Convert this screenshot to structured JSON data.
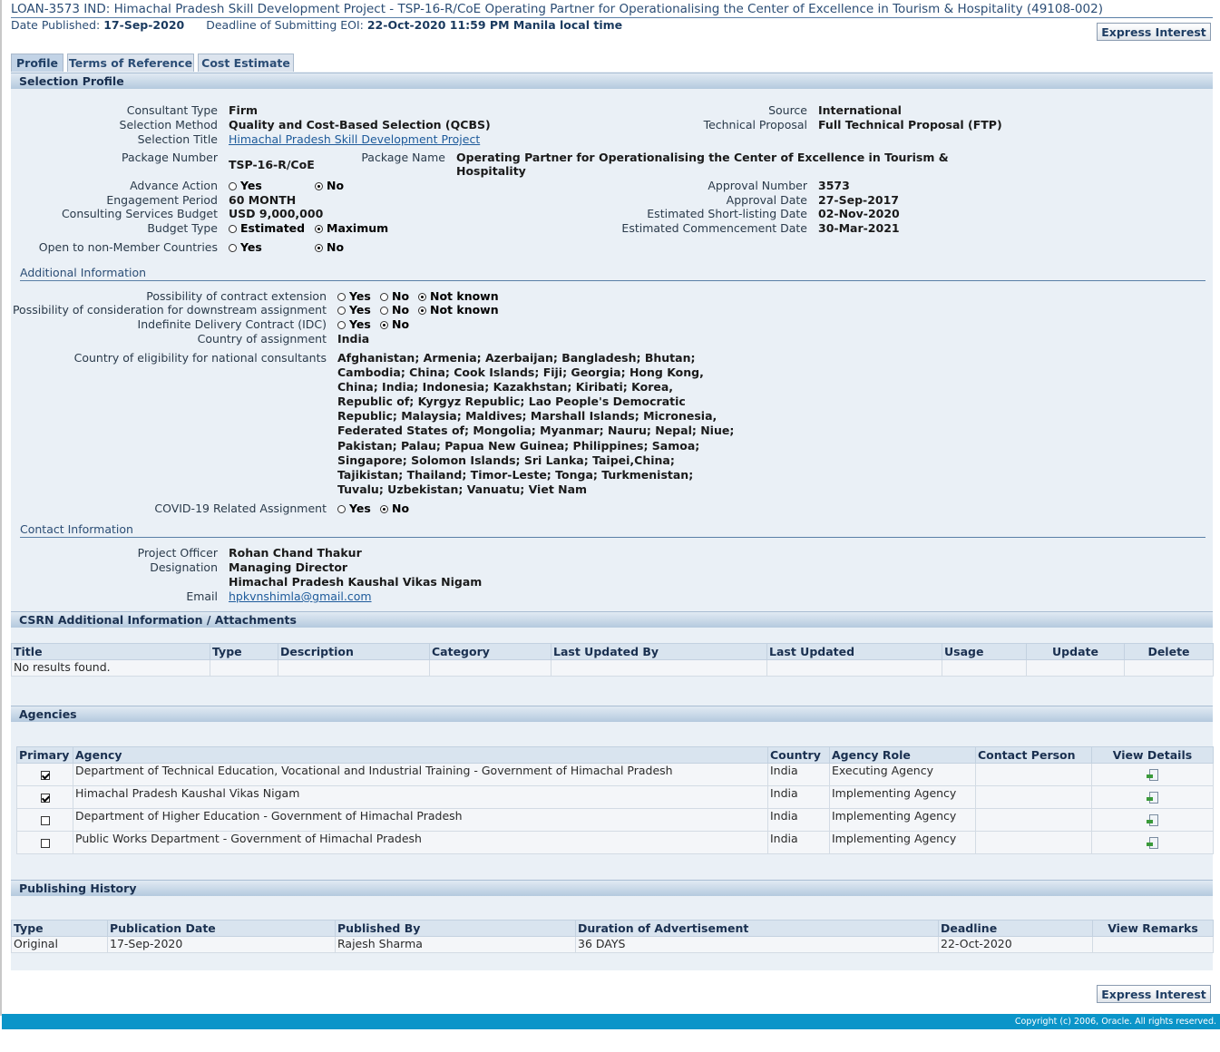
{
  "header": {
    "title": "LOAN-3573 IND: Himachal Pradesh Skill Development Project - TSP-16-R/CoE Operating Partner for Operationalising the Center of Excellence in Tourism & Hospitality (49108-002)",
    "date_published_label": "Date Published:",
    "date_published": "17-Sep-2020",
    "deadline_label": "Deadline of Submitting EOI:",
    "deadline": "22-Oct-2020 11:59 PM Manila local time",
    "express_interest": "Express Interest"
  },
  "tabs": [
    {
      "label": "Profile",
      "active": true
    },
    {
      "label": "Terms of Reference",
      "active": false
    },
    {
      "label": "Cost Estimate",
      "active": false
    }
  ],
  "selection_profile": {
    "title": "Selection Profile",
    "consultant_type_label": "Consultant Type",
    "consultant_type": "Firm",
    "selection_method_label": "Selection Method",
    "selection_method": "Quality and Cost-Based Selection (QCBS)",
    "selection_title_label": "Selection Title",
    "selection_title": "Himachal Pradesh Skill Development Project",
    "package_number_label": "Package Number",
    "package_number": "TSP-16-R/CoE",
    "package_name_label": "Package Name",
    "package_name_line1": "Operating Partner for Operationalising the Center of Excellence in Tourism &",
    "package_name_line2": "Hospitality",
    "advance_action_label": "Advance Action",
    "advance_action_options": [
      "Yes",
      "No"
    ],
    "advance_action_selected": "No",
    "engagement_period_label": "Engagement Period",
    "engagement_period": "60 MONTH",
    "consulting_budget_label": "Consulting Services Budget",
    "consulting_budget": "USD 9,000,000",
    "budget_type_label": "Budget Type",
    "budget_type_options": [
      "Estimated",
      "Maximum"
    ],
    "budget_type_selected": "Maximum",
    "open_nonmember_label": "Open to non-Member Countries",
    "open_nonmember_options": [
      "Yes",
      "No"
    ],
    "open_nonmember_selected": "No",
    "source_label": "Source",
    "source": "International",
    "technical_proposal_label": "Technical Proposal",
    "technical_proposal": "Full Technical Proposal (FTP)",
    "approval_number_label": "Approval Number",
    "approval_number": "3573",
    "approval_date_label": "Approval Date",
    "approval_date": "27-Sep-2017",
    "shortlisting_label": "Estimated Short-listing Date",
    "shortlisting_date": "02-Nov-2020",
    "commencement_label": "Estimated Commencement Date",
    "commencement_date": "30-Mar-2021"
  },
  "additional_info": {
    "title": "Additional Information",
    "extension_label": "Possibility of contract extension",
    "downstream_label": "Possibility of consideration for downstream assignment",
    "idc_label": "Indefinite Delivery Contract (IDC)",
    "opt_yes": "Yes",
    "opt_no": "No",
    "opt_not_known": "Not known",
    "extension_selected": "Not known",
    "downstream_selected": "Not known",
    "idc_selected": "No",
    "country_assignment_label": "Country of assignment",
    "country_assignment": "India",
    "eligibility_label": "Country of eligibility for national consultants",
    "eligibility_lines": [
      "Afghanistan; Armenia; Azerbaijan; Bangladesh; Bhutan;",
      "Cambodia; China; Cook Islands; Fiji; Georgia; Hong Kong,",
      "China; India; Indonesia; Kazakhstan; Kiribati; Korea,",
      "Republic of; Kyrgyz Republic; Lao People's Democratic",
      "Republic; Malaysia; Maldives; Marshall Islands; Micronesia,",
      "Federated States of; Mongolia; Myanmar; Nauru; Nepal; Niue;",
      "Pakistan; Palau; Papua New Guinea; Philippines; Samoa;",
      "Singapore; Solomon Islands; Sri Lanka; Taipei,China;",
      "Tajikistan; Thailand; Timor-Leste; Tonga; Turkmenistan;",
      "Tuvalu; Uzbekistan; Vanuatu; Viet Nam"
    ],
    "covid_label": "COVID-19 Related Assignment",
    "covid_selected": "No"
  },
  "contact": {
    "title": "Contact Information",
    "officer_label": "Project Officer",
    "officer": "Rohan Chand Thakur",
    "designation_label": "Designation",
    "designation": "Managing Director",
    "organization": "Himachal Pradesh Kaushal Vikas Nigam",
    "email_label": "Email",
    "email": "hpkvnshimla@gmail.com"
  },
  "attachments": {
    "title": "CSRN Additional Information / Attachments",
    "columns": [
      "Title",
      "Type",
      "Description",
      "Category",
      "Last Updated By",
      "Last Updated",
      "Usage",
      "Update",
      "Delete"
    ],
    "empty": "No results found."
  },
  "agencies": {
    "title": "Agencies",
    "columns": [
      "Primary",
      "Agency",
      "Country",
      "Agency Role",
      "Contact Person",
      "View Details"
    ],
    "rows": [
      {
        "primary": true,
        "agency": "Department of Technical Education, Vocational and Industrial Training - Government of Himachal Pradesh",
        "country": "India",
        "role": "Executing Agency",
        "contact": ""
      },
      {
        "primary": true,
        "agency": "Himachal Pradesh Kaushal Vikas Nigam",
        "country": "India",
        "role": "Implementing Agency",
        "contact": ""
      },
      {
        "primary": false,
        "agency": "Department of Higher Education - Government of Himachal Pradesh",
        "country": "India",
        "role": "Implementing Agency",
        "contact": ""
      },
      {
        "primary": false,
        "agency": "Public Works Department - Government of Himachal Pradesh",
        "country": "India",
        "role": "Implementing Agency",
        "contact": ""
      }
    ]
  },
  "publishing": {
    "title": "Publishing History",
    "columns": [
      "Type",
      "Publication Date",
      "Published By",
      "Duration of Advertisement",
      "Deadline",
      "View Remarks"
    ],
    "rows": [
      {
        "type": "Original",
        "date": "17-Sep-2020",
        "by": "Rajesh Sharma",
        "duration": "36 DAYS",
        "deadline": "22-Oct-2020"
      }
    ]
  },
  "footer": {
    "copyright": "Copyright (c) 2006, Oracle. All rights reserved."
  },
  "icons": {
    "view_details": "view-details-icon",
    "radio": "radio-icon",
    "checkbox": "checkbox-icon"
  },
  "colors": {
    "accent": "#2b4d75",
    "footer_bar": "#0b95c9",
    "panel_bg": "#eaf0f6"
  }
}
